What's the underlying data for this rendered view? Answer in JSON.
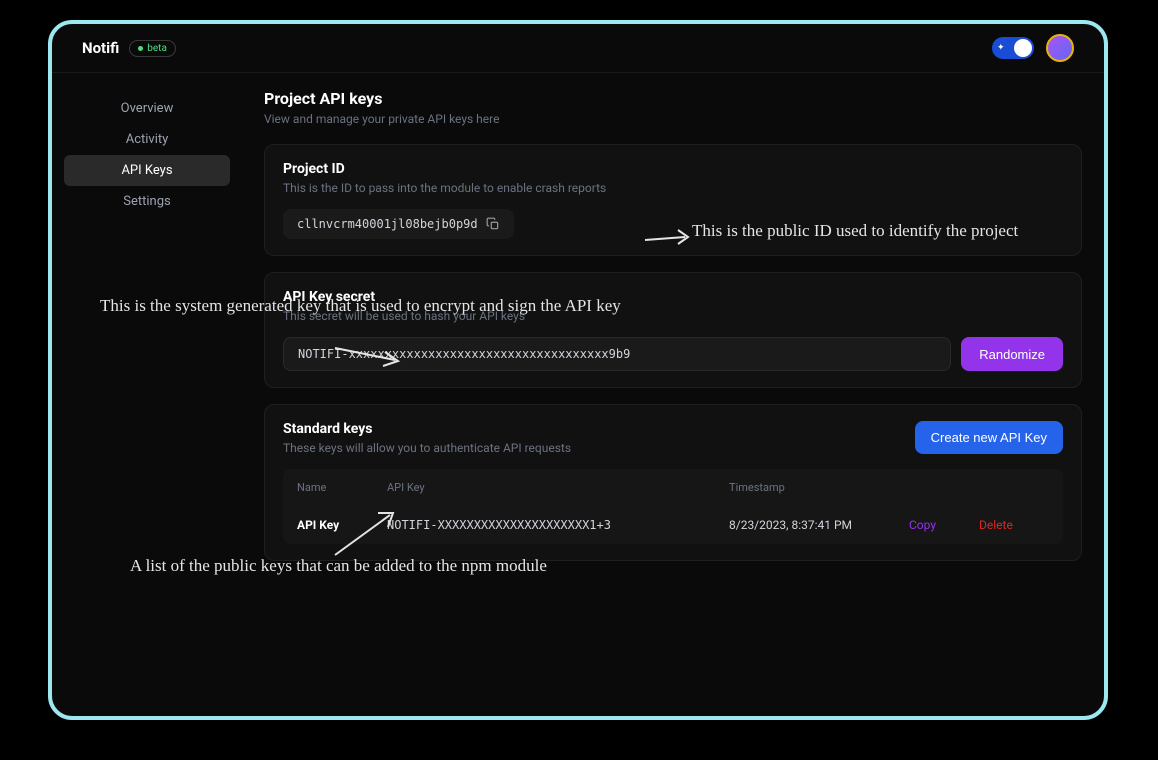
{
  "header": {
    "brand": "Notifi",
    "badge": "beta"
  },
  "sidebar": {
    "items": [
      {
        "label": "Overview"
      },
      {
        "label": "Activity"
      },
      {
        "label": "API Keys"
      },
      {
        "label": "Settings"
      }
    ]
  },
  "page": {
    "title": "Project API keys",
    "subtitle": "View and manage your private API keys here"
  },
  "projectId": {
    "title": "Project ID",
    "subtitle": "This is the ID to pass into the module to enable crash reports",
    "value": "cllnvcrm40001jl08bejb0p9d"
  },
  "apiSecret": {
    "title": "API Key secret",
    "subtitle": "This secret will be used to hash your API keys",
    "value": "NOTIFI-xxxxxxxxxxxxxxxxxxxxxxxxxxxxxxxxxxxx9b9",
    "buttonLabel": "Randomize"
  },
  "standardKeys": {
    "title": "Standard keys",
    "subtitle": "These keys will allow you to authenticate API requests",
    "createLabel": "Create new API Key",
    "columns": {
      "name": "Name",
      "apiKey": "API Key",
      "timestamp": "Timestamp"
    },
    "rows": [
      {
        "name": "API Key",
        "key": "NOTIFI-XXXXXXXXXXXXXXXXXXXXX1+3",
        "timestamp": "8/23/2023, 8:37:41 PM",
        "copyLabel": "Copy",
        "deleteLabel": "Delete"
      }
    ]
  },
  "annotations": {
    "projectId": "This is the public ID used to identify the project",
    "secret": "This is the system generated key that is used to encrypt and sign the API key",
    "keysList": "A list of the public keys that can be added to the npm module"
  }
}
